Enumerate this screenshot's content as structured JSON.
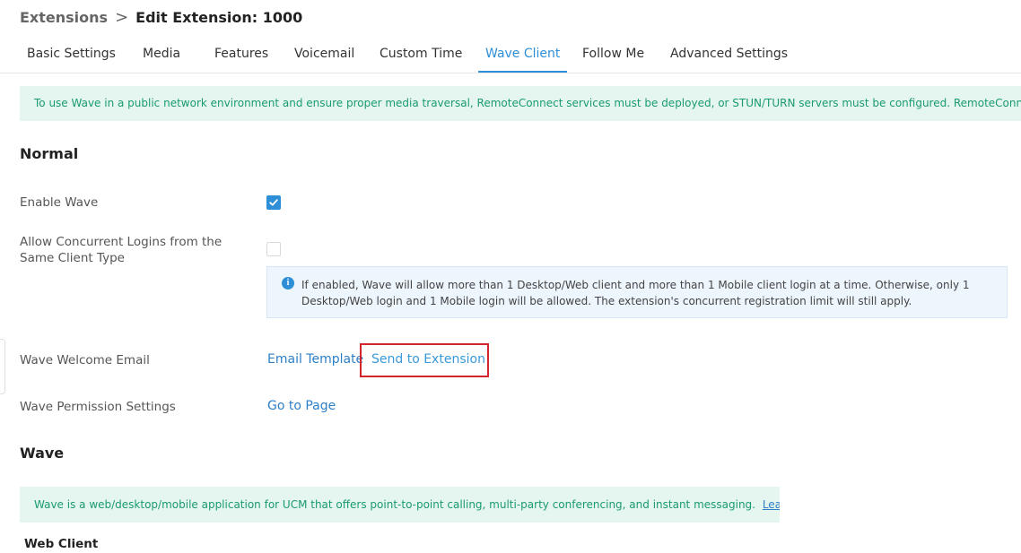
{
  "breadcrumb": {
    "parent": "Extensions",
    "separator": ">",
    "current": "Edit Extension: 1000"
  },
  "tabs": [
    {
      "label": "Basic Settings",
      "active": false
    },
    {
      "label": "Media",
      "active": false
    },
    {
      "label": "Features",
      "active": false
    },
    {
      "label": "Voicemail",
      "active": false
    },
    {
      "label": "Custom Time",
      "active": false
    },
    {
      "label": "Wave Client",
      "active": true
    },
    {
      "label": "Follow Me",
      "active": false
    },
    {
      "label": "Advanced Settings",
      "active": false
    }
  ],
  "notice": "To use Wave in a public network environment and ensure proper media traversal, RemoteConnect services must be deployed, or STUN/TURN servers must be configured. RemoteConnect is recomm",
  "normal": {
    "title": "Normal",
    "enable_wave": {
      "label": "Enable Wave",
      "checked": true
    },
    "concurrent_logins": {
      "label": "Allow Concurrent Logins from the Same Client Type",
      "checked": false,
      "info_line1": "If enabled, Wave will allow more than 1 Desktop/Web client and more than 1 Mobile client login at a time. Otherwise, only 1",
      "info_line2": "Desktop/Web login and 1 Mobile login will be allowed. The extension's concurrent registration limit will still apply."
    },
    "welcome_email": {
      "label": "Wave Welcome Email",
      "email_template": "Email Template",
      "send_to_extension": "Send to Extension"
    },
    "permission_settings": {
      "label": "Wave Permission Settings",
      "go_to_page": "Go to Page"
    }
  },
  "wave": {
    "title": "Wave",
    "notice": "Wave is a web/desktop/mobile application for UCM that offers point-to-point calling, multi-party conferencing, and instant messaging.",
    "learn_more": "Learn more",
    "web_client_title": "Web Client"
  },
  "colors": {
    "accent": "#2e8fd6",
    "notice_bg": "#e4f6ef",
    "notice_text": "#1a9a72",
    "highlight": "#d3242b"
  },
  "icons": {
    "check": "checkmark-icon",
    "info": "info-icon"
  }
}
